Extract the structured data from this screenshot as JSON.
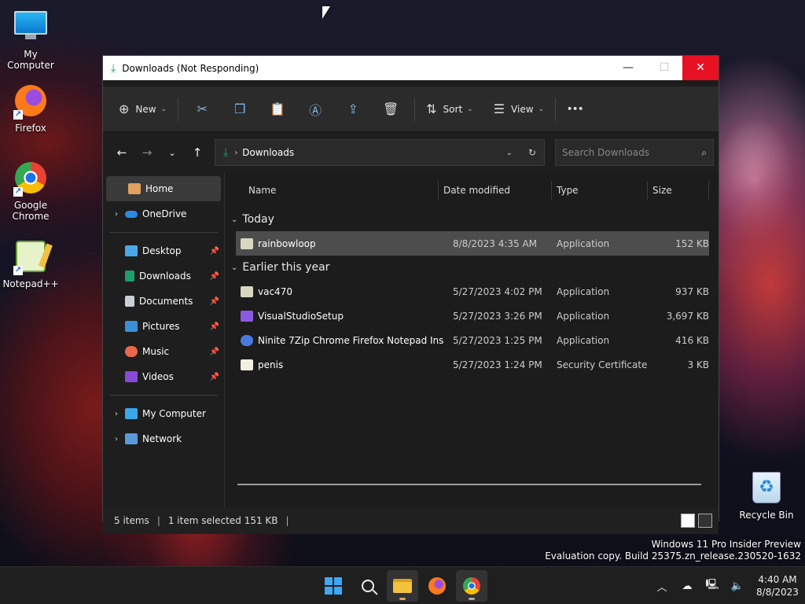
{
  "desktop": {
    "icons": [
      {
        "label": "My Computer"
      },
      {
        "label": "Firefox"
      },
      {
        "label": "Google Chrome"
      },
      {
        "label": "Notepad++"
      },
      {
        "label": "Recycle Bin"
      }
    ],
    "watermark": {
      "line1": "Windows 11 Pro Insider Preview",
      "line2": "Evaluation copy. Build 25375.zn_release.230520-1632"
    }
  },
  "window": {
    "title": "Downloads (Not Responding)",
    "toolbar": {
      "new_label": "New",
      "sort_label": "Sort",
      "view_label": "View",
      "more_label": "•••"
    },
    "address": {
      "path": "Downloads",
      "search_placeholder": "Search Downloads"
    },
    "nav": {
      "home": "Home",
      "onedrive": "OneDrive",
      "quick": [
        "Desktop",
        "Downloads",
        "Documents",
        "Pictures",
        "Music",
        "Videos"
      ],
      "my_computer": "My Computer",
      "network": "Network"
    },
    "columns": {
      "name": "Name",
      "date": "Date modified",
      "type": "Type",
      "size": "Size"
    },
    "groups": {
      "today": "Today",
      "earlier": "Earlier this year"
    },
    "files_today": [
      {
        "name": "rainbowloop",
        "date": "8/8/2023 4:35 AM",
        "type": "Application",
        "size": "152 KB"
      }
    ],
    "files_earlier": [
      {
        "name": "vac470",
        "date": "5/27/2023 4:02 PM",
        "type": "Application",
        "size": "937 KB"
      },
      {
        "name": "VisualStudioSetup",
        "date": "5/27/2023 3:26 PM",
        "type": "Application",
        "size": "3,697 KB"
      },
      {
        "name": "Ninite 7Zip Chrome Firefox Notepad Inst...",
        "date": "5/27/2023 1:25 PM",
        "type": "Application",
        "size": "416 KB"
      },
      {
        "name": "penis",
        "date": "5/27/2023 1:24 PM",
        "type": "Security Certificate",
        "size": "3 KB"
      }
    ],
    "status": {
      "items": "5 items",
      "selected": "1 item selected  151 KB"
    }
  },
  "taskbar": {
    "time": "4:40 AM",
    "date": "8/8/2023"
  }
}
